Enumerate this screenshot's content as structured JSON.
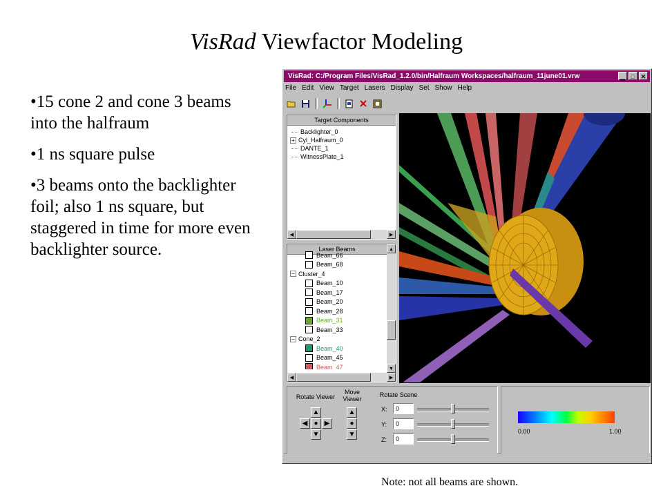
{
  "slide": {
    "title_italic": "VisRad",
    "title_rest": " Viewfactor Modeling",
    "bullets": [
      "•15 cone 2 and cone 3 beams into the halfraum",
      "•1 ns square pulse",
      "•3 beams onto the backlighter foil; also 1 ns square, but staggered in time for more even backlighter source."
    ],
    "note": "Note: not all beams are shown."
  },
  "window": {
    "title": "VisRad:  C:/Program Files/VisRad_1.2.0/bin/Halfraum Workspaces/halfraum_11june01.vrw",
    "title_color": "#8b0a6a",
    "buttons": {
      "minimize": "▁",
      "maximize": "□",
      "close": "✕"
    },
    "menu": [
      "File",
      "Edit",
      "View",
      "Target",
      "Lasers",
      "Display",
      "Set",
      "Show",
      "Help"
    ],
    "toolbar_icons": [
      "open-folder-icon",
      "save-disk-icon",
      "axes-icon",
      "new-doc-icon",
      "delete-x-icon",
      "report-icon"
    ]
  },
  "target_components": {
    "header": "Target Components",
    "items": [
      {
        "label": "Backlighter_0",
        "expandable": false
      },
      {
        "label": "Cyl_Halfraum_0",
        "expandable": true
      },
      {
        "label": "DANTE_1",
        "expandable": false
      },
      {
        "label": "WitnessPlate_1",
        "expandable": false
      }
    ]
  },
  "laser_beams": {
    "header": "Laser Beams",
    "rows": [
      {
        "label": "Beam_66",
        "color": "#000000",
        "fill": "#ffffff",
        "indent": 2
      },
      {
        "label": "Beam_68",
        "color": "#000000",
        "fill": "#ffffff",
        "indent": 2
      },
      {
        "label": "Cluster_4",
        "color": "#000000",
        "group": true,
        "indent": 0
      },
      {
        "label": "Beam_10",
        "color": "#000000",
        "fill": "#ffffff",
        "indent": 2
      },
      {
        "label": "Beam_17",
        "color": "#000000",
        "fill": "#ffffff",
        "indent": 2
      },
      {
        "label": "Beam_20",
        "color": "#000000",
        "fill": "#ffffff",
        "indent": 2
      },
      {
        "label": "Beam_28",
        "color": "#000000",
        "fill": "#ffffff",
        "indent": 2
      },
      {
        "label": "Beam_31",
        "color": "#6aa833",
        "fill": "#6aa833",
        "indent": 2
      },
      {
        "label": "Beam_33",
        "color": "#000000",
        "fill": "#ffffff",
        "indent": 2
      },
      {
        "label": "Cone_2",
        "color": "#000000",
        "group": true,
        "indent": 0
      },
      {
        "label": "Beam_40",
        "color": "#1d9b67",
        "fill": "#1d9b67",
        "indent": 2
      },
      {
        "label": "Beam_45",
        "color": "#000000",
        "fill": "#ffffff",
        "indent": 2
      },
      {
        "label": "Beam_47",
        "color": "#d05858",
        "fill": "#d05858",
        "indent": 2
      }
    ]
  },
  "controls": {
    "rotate_viewer": "Rotate Viewer",
    "move_viewer": "Move\nViewer",
    "rotate_scene": "Rotate Scene",
    "axes": [
      {
        "label": "X:",
        "value": "0",
        "slider": 0.5
      },
      {
        "label": "Y:",
        "value": "0",
        "slider": 0.5
      },
      {
        "label": "Z:",
        "value": "0",
        "slider": 0.5
      }
    ]
  },
  "colorbar": {
    "min": "0.00",
    "max": "1.00"
  }
}
